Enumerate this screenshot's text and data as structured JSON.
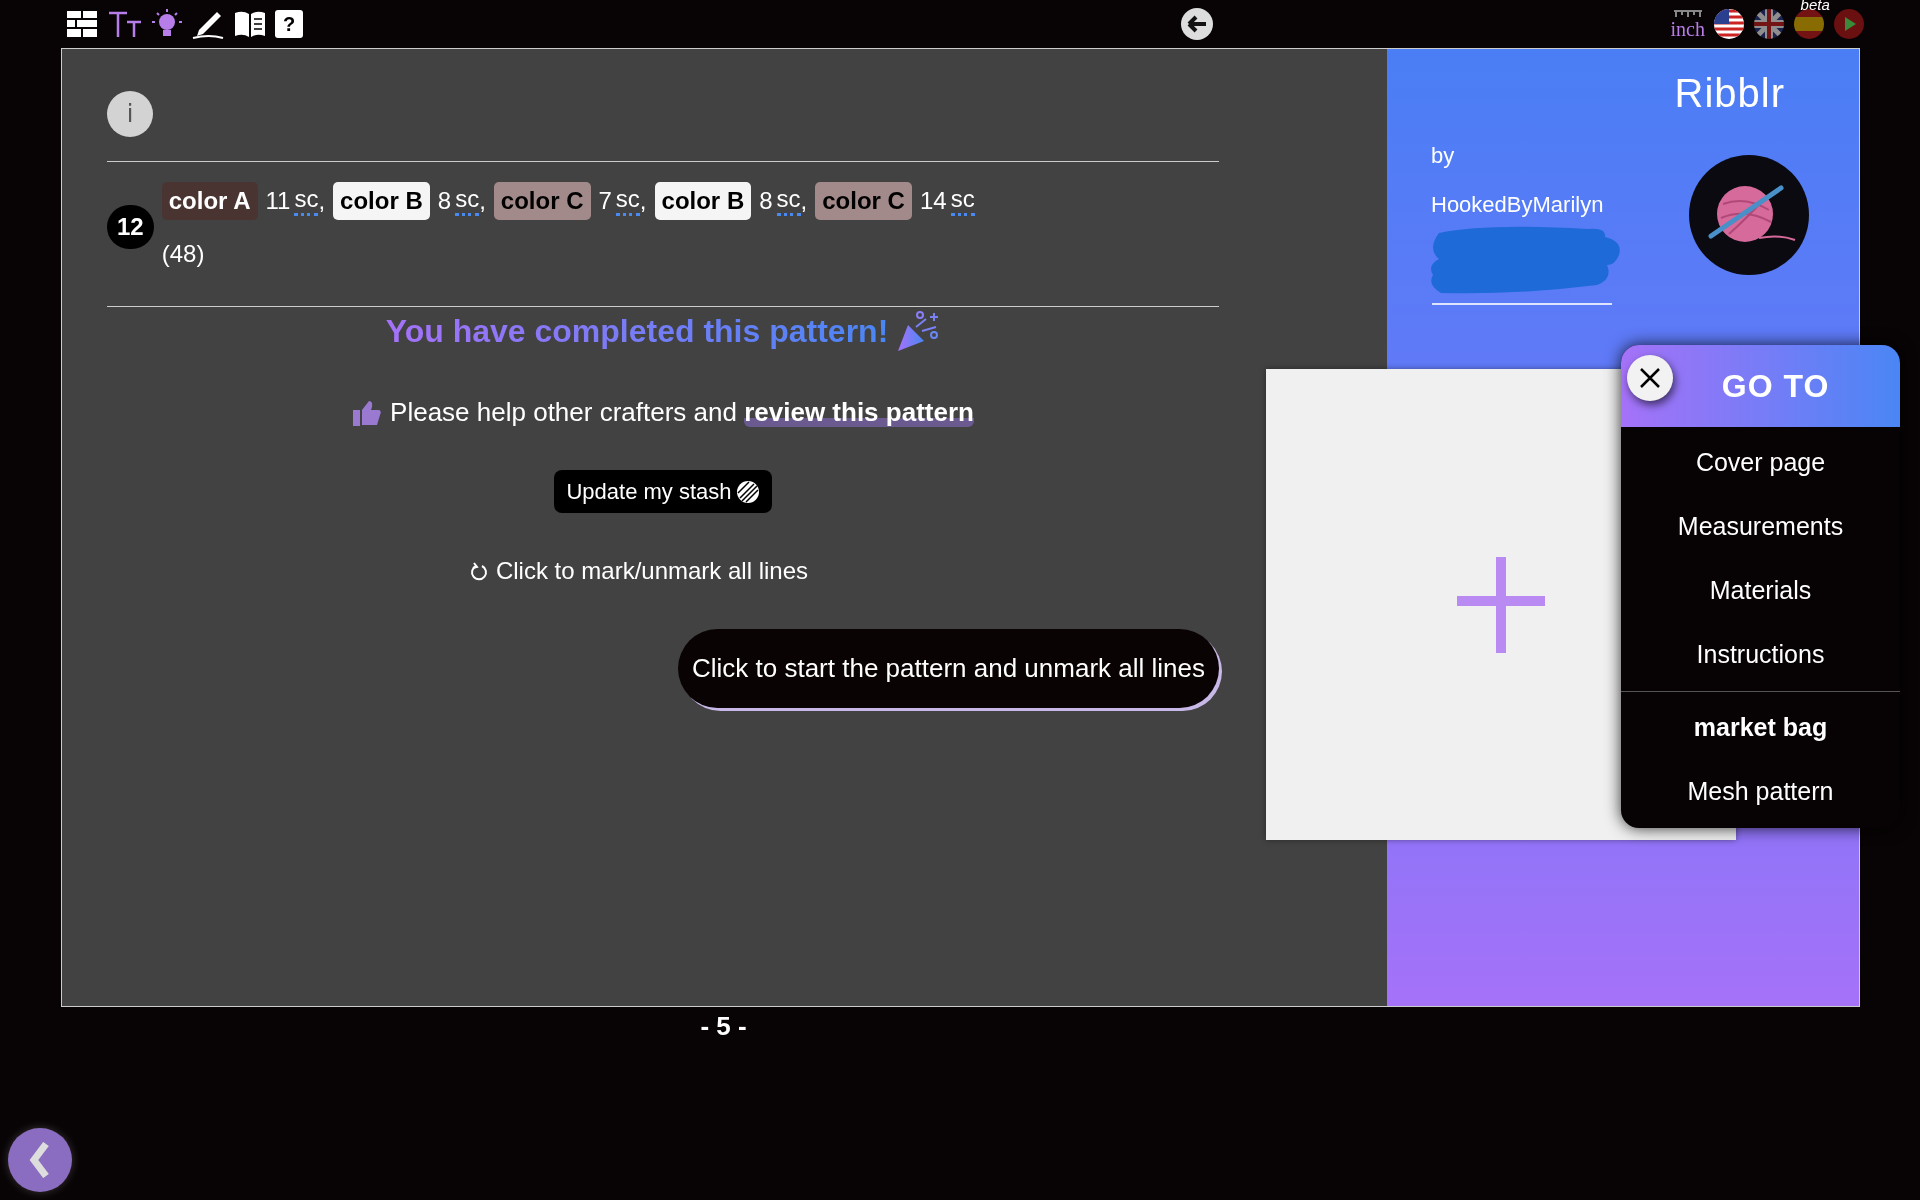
{
  "toolbar": {
    "help_label": "?",
    "unit": "inch",
    "beta": "beta"
  },
  "info": {
    "label": "i"
  },
  "row": {
    "number": "12",
    "total": "(48)",
    "chips": [
      {
        "label": "color A",
        "color": "#4a3432",
        "count": "11",
        "stitch": "sc",
        "separator": ","
      },
      {
        "label": "color B",
        "color": "#f5f5f5",
        "count": "8",
        "stitch": "sc",
        "separator": ","
      },
      {
        "label": "color C",
        "color": "#a38a8a",
        "count": "7",
        "stitch": "sc",
        "separator": ","
      },
      {
        "label": "color B",
        "color": "#f5f5f5",
        "count": "8",
        "stitch": "sc",
        "separator": ","
      },
      {
        "label": "color C",
        "color": "#a38a8a",
        "count": "14",
        "stitch": "sc"
      }
    ]
  },
  "completion": {
    "title": "You have completed this pattern!",
    "review_text": "Please help other crafters and",
    "review_link": "review this pattern",
    "stash_button": "Update my stash",
    "mark_all": "Click to mark/unmark all lines",
    "start_button": "Click to start the pattern and unmark all lines"
  },
  "cover": {
    "logo": "Ribblr",
    "by": "by",
    "author": "HookedByMarilyn"
  },
  "goto": {
    "title": "GO TO",
    "groups": [
      [
        {
          "label": "Cover page",
          "kind": "link"
        },
        {
          "label": "Measurements",
          "kind": "link"
        },
        {
          "label": "Materials",
          "kind": "link"
        },
        {
          "label": "Instructions",
          "kind": "link"
        }
      ],
      [
        {
          "label": "market bag",
          "kind": "heading"
        },
        {
          "label": "Mesh pattern",
          "kind": "link"
        }
      ]
    ]
  },
  "page_number": "- 5 -"
}
